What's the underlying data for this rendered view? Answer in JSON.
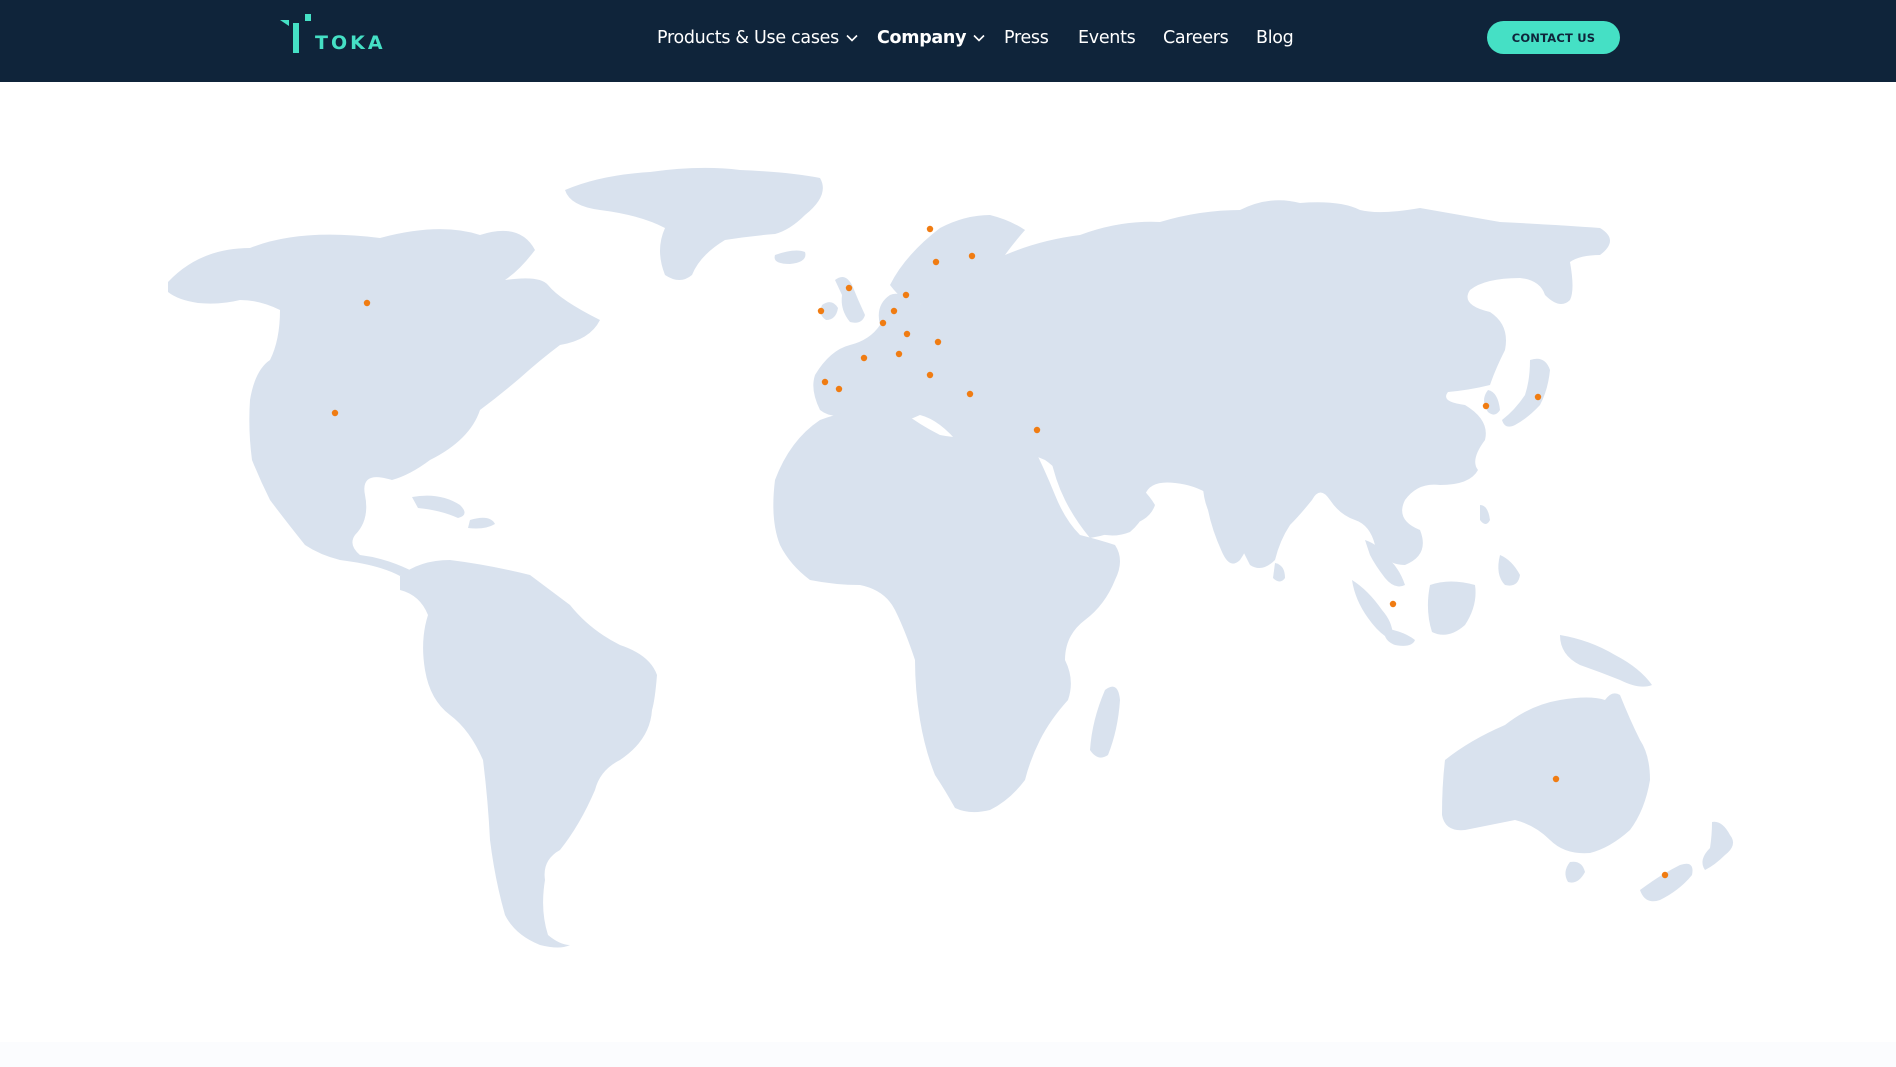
{
  "brand": {
    "logo_text": "TOKA",
    "accent_color": "#45e0c5",
    "nav_background": "#0f243a"
  },
  "nav": {
    "items": [
      {
        "label": "Products & Use cases",
        "has_dropdown": true
      },
      {
        "label": "Company",
        "has_dropdown": true,
        "active": true
      },
      {
        "label": "Press",
        "has_dropdown": false
      },
      {
        "label": "Events",
        "has_dropdown": false
      },
      {
        "label": "Careers",
        "has_dropdown": false
      },
      {
        "label": "Blog",
        "has_dropdown": false
      }
    ],
    "contact_button": "CONTACT US"
  },
  "map": {
    "land_color": "#d9e2ee",
    "marker_color": "#f07c12",
    "icons": [
      "logo-icon",
      "chevron-down-icon",
      "location-marker-icon"
    ]
  }
}
